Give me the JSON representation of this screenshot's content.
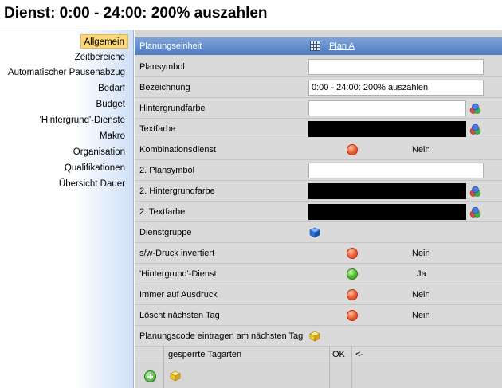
{
  "window": {
    "title": "Dienst: 0:00 - 24:00: 200% auszahlen"
  },
  "sidebar": {
    "items": [
      {
        "label": "Allgemein",
        "active": true
      },
      {
        "label": "Zeitbereiche"
      },
      {
        "label": "Automatischer Pausenabzug"
      },
      {
        "label": "Bedarf"
      },
      {
        "label": "Budget"
      },
      {
        "label": "'Hintergrund'-Dienste"
      },
      {
        "label": "Makro"
      },
      {
        "label": "Organisation"
      },
      {
        "label": "Qualifikationen"
      },
      {
        "label": "Übersicht Dauer"
      }
    ]
  },
  "header": {
    "label": "Planungseinheit",
    "plan_link": "Plan A",
    "plan_icon": "grid-calendar-icon"
  },
  "rows": {
    "plansymbol": {
      "label": "Plansymbol",
      "value": ""
    },
    "bezeichnung": {
      "label": "Bezeichnung",
      "value": "0:00 - 24:00: 200% auszahlen"
    },
    "hintergrundfarbe": {
      "label": "Hintergrundfarbe",
      "color": "#ffffff"
    },
    "textfarbe": {
      "label": "Textfarbe",
      "color": "#000000"
    },
    "kombinationsdienst": {
      "label": "Kombinationsdienst",
      "value": "Nein",
      "status_color": "red"
    },
    "plansymbol2": {
      "label": "2. Plansymbol",
      "value": ""
    },
    "hintergrundfarbe2": {
      "label": "2. Hintergrundfarbe",
      "color": "#000000"
    },
    "textfarbe2": {
      "label": "2. Textfarbe",
      "color": "#000000"
    },
    "dienstgruppe": {
      "label": "Dienstgruppe",
      "icon": "blue-cube-icon"
    },
    "sw_druck": {
      "label": "s/w-Druck invertiert",
      "value": "Nein",
      "status_color": "red"
    },
    "hintergrund_dienst": {
      "label": "'Hintergrund'-Dienst",
      "value": "Ja",
      "status_color": "green"
    },
    "immer_ausdruck": {
      "label": "Immer auf Ausdruck",
      "value": "Nein",
      "status_color": "red"
    },
    "loescht_tag": {
      "label": "Löscht nächsten Tag",
      "value": "Nein",
      "status_color": "red"
    },
    "planungscode": {
      "label": "Planungscode eintragen am nächsten Tag",
      "icon": "yellow-cube-icon"
    }
  },
  "table": {
    "columns": [
      "gesperrte Tagarten",
      "OK",
      "<-"
    ],
    "add_icon": "add-green-icon",
    "select_icon": "yellow-cube-icon"
  },
  "colors": {
    "header_blue": "#5b86c6",
    "active_tab": "#fcd77a",
    "panel_grey": "#d6d6d6"
  }
}
